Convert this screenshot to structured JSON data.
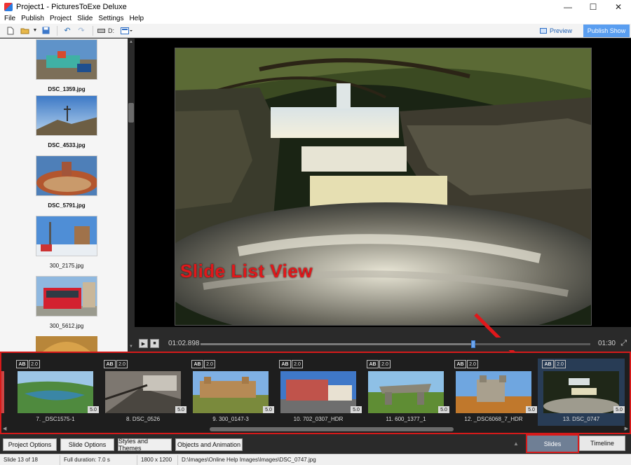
{
  "window": {
    "title": "Project1 - PicturesToExe Deluxe",
    "controls": [
      "minimize",
      "maximize",
      "close"
    ]
  },
  "menu": [
    "File",
    "Publish",
    "Project",
    "Slide",
    "Settings",
    "Help"
  ],
  "toolbar": {
    "drive_label": "D:",
    "preview_label": "Preview",
    "publish_label": "Publish Show",
    "icons": [
      "new-file-icon",
      "open-folder-icon",
      "dropdown-icon",
      "save-icon",
      "undo-icon",
      "redo-icon",
      "drive-icon",
      "view-mode-icon"
    ]
  },
  "file_list": [
    {
      "name": "DSC_1359.jpg"
    },
    {
      "name": "DSC_4533.jpg"
    },
    {
      "name": "DSC_5791.jpg"
    },
    {
      "name": "300_2175.jpg"
    },
    {
      "name": "300_5612.jpg"
    }
  ],
  "annotation": {
    "text": "Slide List View",
    "color": "#e0181b"
  },
  "playback": {
    "current_time": "01:02.898",
    "total_time": "01:30",
    "progress": 0.699
  },
  "slides": [
    {
      "label": "7. _DSC1575-1",
      "ab": "AB",
      "duration": "2.0",
      "transition": "5.0",
      "selected": false
    },
    {
      "label": "8. DSC_0526",
      "ab": "AB",
      "duration": "2.0",
      "transition": "5.0",
      "selected": false
    },
    {
      "label": "9. 300_0147-3",
      "ab": "AB",
      "duration": "2.0",
      "transition": "5.0",
      "selected": false
    },
    {
      "label": "10. 702_0307_HDR",
      "ab": "AB",
      "duration": "2.0",
      "transition": "5.0",
      "selected": false
    },
    {
      "label": "11. 600_1377_1",
      "ab": "AB",
      "duration": "2.0",
      "transition": "5.0",
      "selected": false
    },
    {
      "label": "12. _DSC6068_7_HDR",
      "ab": "AB",
      "duration": "2.0",
      "transition": "5.0",
      "selected": false
    },
    {
      "label": "13. DSC_0747",
      "ab": "AB",
      "duration": "2.0",
      "transition": "5.0",
      "selected": true
    }
  ],
  "bottom_buttons": [
    "Project Options",
    "Slide Options",
    "Styles and Themes",
    "Objects and Animation"
  ],
  "view_tabs": {
    "slides": "Slides",
    "timeline": "Timeline",
    "active": "Slides"
  },
  "status": {
    "slide": "Slide 13 of 18",
    "duration": "Full duration: 7.0 s",
    "resolution": "1800 x 1200",
    "path": "D:\\Images\\Online Help Images\\Images\\DSC_0747.jpg"
  },
  "colors": {
    "highlight_border": "#d61a1a",
    "publish_button": "#5a9ef0",
    "selected_slide": "#283c55"
  }
}
